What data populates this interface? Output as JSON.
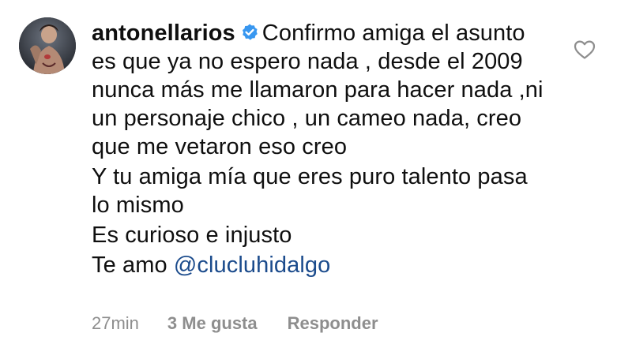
{
  "comment": {
    "username": "antonellarios",
    "verified": true,
    "paragraphs": [
      "Confirmo amiga el asunto es que ya no espero nada , desde el 2009 nunca más me llamaron para hacer nada ,ni un personaje chico , un cameo nada, creo que me vetaron eso creo",
      "Y tu amiga mía que eres puro talento pasa lo mismo",
      "Es curioso e injusto"
    ],
    "last_line_prefix": "Te amo ",
    "mention": "@clucluhidalgo",
    "time": "27min",
    "likes": "3 Me gusta",
    "reply_label": "Responder"
  },
  "icons": {
    "verified": "verified-badge-icon",
    "like": "heart-outline-icon"
  },
  "colors": {
    "text": "#0f0f0f",
    "meta": "#8e8e8e",
    "mention": "#1b4b8c",
    "verified": "#3897f0"
  }
}
